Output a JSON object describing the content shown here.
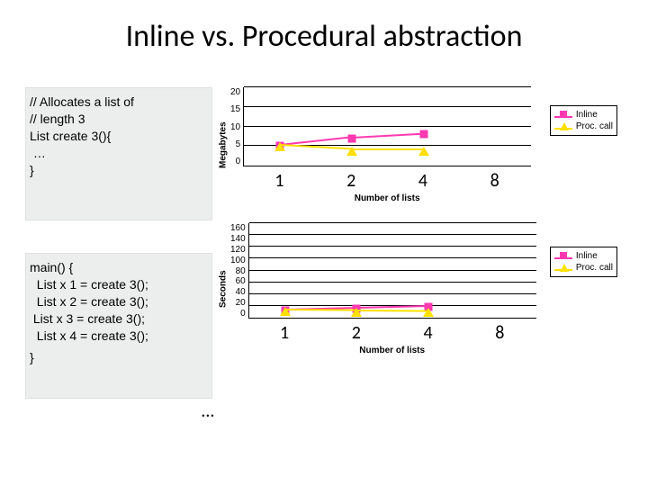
{
  "title": "Inline vs. Procedural abstraction",
  "code1": {
    "l1": "// Allocates a list of",
    "l2": "// length 3",
    "l3": "List create 3(){",
    "l4": " …",
    "l5": "}"
  },
  "code2": {
    "l1": "main() {",
    "l2": "  List x 1 = create 3();",
    "l3": "  List x 2 = create 3();",
    "l4": " List x 3 = create 3();",
    "l5": "  List x 4 = create 3();",
    "l6": "}"
  },
  "ellipsis": "…",
  "legend": {
    "inline": "Inline",
    "proc": "Proc. call"
  },
  "chart_data": [
    {
      "type": "line",
      "title": "",
      "xlabel": "Number of lists",
      "ylabel": "Megabytes",
      "categories": [
        "1",
        "2",
        "4",
        "8"
      ],
      "yticks": [
        0,
        5,
        10,
        15,
        20
      ],
      "ylim": [
        0,
        20
      ],
      "series": [
        {
          "name": "Inline",
          "color": "#ff39b0",
          "shape": "square",
          "values": [
            5,
            7,
            8,
            null
          ]
        },
        {
          "name": "Proc. call",
          "color": "#ffe000",
          "shape": "triangle",
          "values": [
            5,
            4,
            4,
            null
          ]
        }
      ]
    },
    {
      "type": "line",
      "title": "",
      "xlabel": "Number of lists",
      "ylabel": "Seconds",
      "categories": [
        "1",
        "2",
        "4",
        "8"
      ],
      "yticks": [
        0,
        20,
        40,
        60,
        80,
        100,
        120,
        140,
        160
      ],
      "ylim": [
        0,
        160
      ],
      "series": [
        {
          "name": "Inline",
          "color": "#ff39b0",
          "shape": "square",
          "values": [
            12,
            15,
            18,
            null
          ]
        },
        {
          "name": "Proc. call",
          "color": "#ffe000",
          "shape": "triangle",
          "values": [
            12,
            11,
            10,
            null
          ]
        }
      ]
    }
  ]
}
